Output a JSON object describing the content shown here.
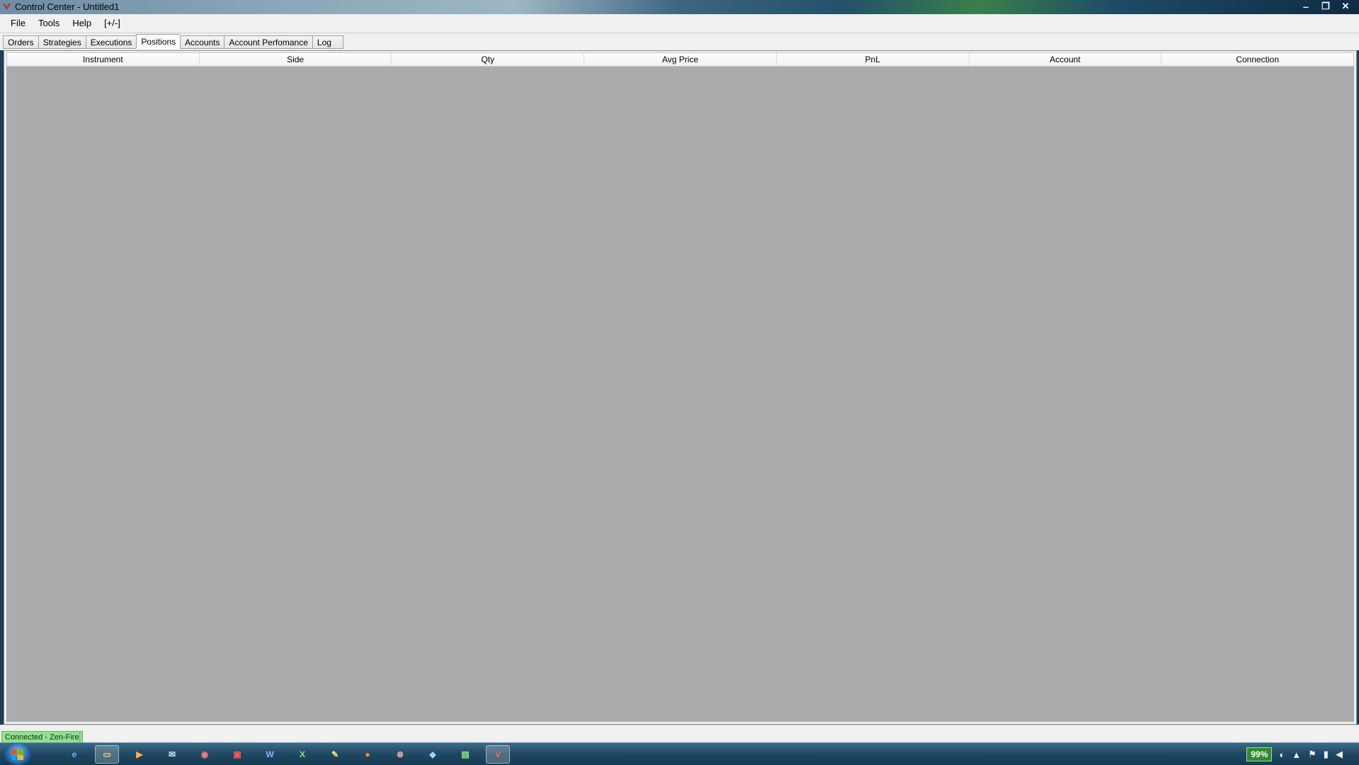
{
  "window": {
    "title": "Control Center - Untitled1",
    "controls": {
      "minimize": "‒",
      "restore": "❐",
      "close": "✕"
    }
  },
  "menu": {
    "items": [
      "File",
      "Tools",
      "Help",
      "[+/-]"
    ]
  },
  "tabs": {
    "items": [
      "Orders",
      "Strategies",
      "Executions",
      "Positions",
      "Accounts",
      "Account Perfomance",
      "Log"
    ],
    "active": "Positions"
  },
  "grid": {
    "columns": [
      "Instrument",
      "Side",
      "Qty",
      "Avg Price",
      "PnL",
      "Account",
      "Connection"
    ],
    "rows": []
  },
  "status": {
    "connection_text": "Connected - Zen-Fire",
    "connection_color": "#8fe08f"
  },
  "taskbar": {
    "icons": [
      "internet-explorer-icon",
      "file-explorer-icon",
      "media-player-icon",
      "mail-icon",
      "app-red-icon",
      "pdf-icon",
      "word-icon",
      "excel-icon",
      "notes-icon",
      "browser-icon",
      "security-icon",
      "app-blue-icon",
      "app-green-icon",
      "control-center-icon"
    ],
    "tray": {
      "battery": "99%"
    }
  }
}
